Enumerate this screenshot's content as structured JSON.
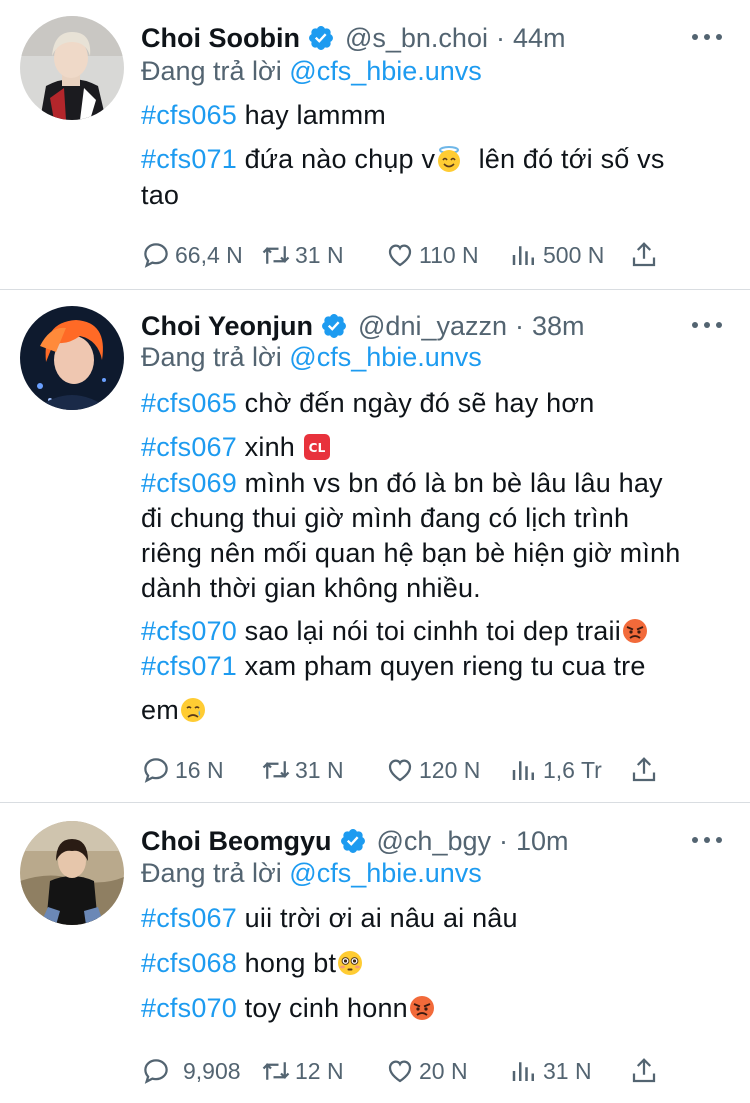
{
  "colors": {
    "link": "#1d9bf0",
    "muted": "#536471",
    "text": "#0f1419",
    "verified": "#1d9bf0"
  },
  "tweets": [
    {
      "name": "Choi Soobin",
      "handle": "@s_bn.choi",
      "dot": "·",
      "time": "44m",
      "reply_prefix": "Đang trả lời",
      "reply_to": "@cfs_hbie.unvs",
      "lines": [
        {
          "tag": "#cfs065",
          "text": " hay lammm"
        },
        {
          "tag": "#cfs071",
          "text": " đứa nào chụp v",
          "emoji": "halo-smile-emoji",
          "after": "  lên đó tới số vs"
        },
        {
          "tag": "",
          "text": "tao"
        }
      ],
      "stats": {
        "replies": "66,4 N",
        "retweets": "31 N",
        "likes": "110 N",
        "views": "500 N"
      }
    },
    {
      "name": "Choi Yeonjun",
      "handle": "@dni_yazzn",
      "dot": "·",
      "time": "38m",
      "reply_prefix": "Đang trả lời",
      "reply_to": "@cfs_hbie.unvs",
      "lines": [
        {
          "tag": "#cfs065",
          "text": " chờ đến ngày đó sẽ hay hơn"
        },
        {
          "tag": "#cfs067",
          "text": " xinh ",
          "emoji": "cl-button-emoji",
          "emoji_text": "CL"
        },
        {
          "tag": "#cfs069",
          "text": " mình vs bn đó là bn bè lâu lâu hay"
        },
        {
          "tag": "",
          "text": "đi chung thui giờ mình đang có lịch trình"
        },
        {
          "tag": "",
          "text": "riêng nên mối quan hệ bạn bè hiện giờ mình"
        },
        {
          "tag": "",
          "text": "dành thời gian không nhiều."
        },
        {
          "tag": "#cfs070",
          "text": " sao lại nói toi cinhh toi dep traii",
          "emoji": "angry-face-emoji"
        },
        {
          "tag": "#cfs071",
          "text": " xam pham quyen rieng tu cua tre"
        },
        {
          "tag": "",
          "text": "em",
          "emoji": "crying-face-emoji"
        }
      ],
      "stats": {
        "replies": "16 N",
        "retweets": "31 N",
        "likes": "120 N",
        "views": "1,6 Tr"
      }
    },
    {
      "name": "Choi Beomgyu",
      "handle": "@ch_bgy",
      "dot": "·",
      "time": "10m",
      "reply_prefix": "Đang trả lời",
      "reply_to": "@cfs_hbie.unvs",
      "lines": [
        {
          "tag": "#cfs067",
          "text": " uii trời ơi ai nâu ai nâu"
        },
        {
          "tag": "#cfs068",
          "text": " hong bt",
          "emoji": "flushed-face-emoji"
        },
        {
          "tag": "#cfs070",
          "text": " toy cinh honn",
          "emoji": "angry-face-emoji"
        }
      ],
      "stats": {
        "replies": "9,908",
        "retweets": "12 N",
        "likes": "20 N",
        "views": "31 N"
      }
    }
  ]
}
